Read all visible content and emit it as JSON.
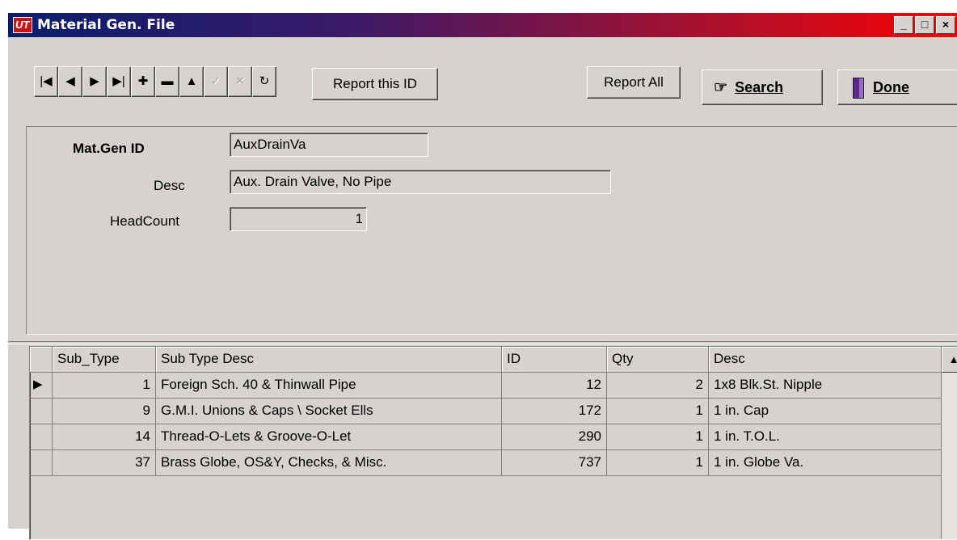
{
  "window": {
    "title": "Material Gen. File",
    "app_icon": "ut-logo-icon",
    "caption_buttons": [
      "_",
      "□",
      "×"
    ]
  },
  "toolbar": {
    "nav_buttons": [
      {
        "name": "first-record-button",
        "glyph": "|◀",
        "enabled": true
      },
      {
        "name": "prev-record-button",
        "glyph": "◀",
        "enabled": true
      },
      {
        "name": "next-record-button",
        "glyph": "▶",
        "enabled": true
      },
      {
        "name": "last-record-button",
        "glyph": "▶|",
        "enabled": true
      },
      {
        "name": "add-record-button",
        "glyph": "✚",
        "enabled": true
      },
      {
        "name": "delete-record-button",
        "glyph": "▬",
        "enabled": true
      },
      {
        "name": "edit-record-button",
        "glyph": "▲",
        "enabled": true
      },
      {
        "name": "post-record-button",
        "glyph": "✓",
        "enabled": false
      },
      {
        "name": "cancel-record-button",
        "glyph": "✕",
        "enabled": false
      },
      {
        "name": "refresh-button",
        "glyph": "↻",
        "enabled": true
      }
    ],
    "report_this_id": "Report this ID",
    "report_all": "Report All",
    "search": "Search",
    "done": "Done"
  },
  "form": {
    "mat_gen_id_label": "Mat.Gen ID",
    "mat_gen_id_value": "AuxDrainVa",
    "desc_label": "Desc",
    "desc_value": "Aux. Drain Valve, No Pipe",
    "headcount_label": "HeadCount",
    "headcount_value": "1"
  },
  "grid": {
    "columns": [
      "Sub_Type",
      "Sub Type Desc",
      "ID",
      "Qty",
      "Desc"
    ],
    "rows": [
      {
        "sub_type": "1",
        "sub_type_desc": "Foreign Sch. 40 & Thinwall Pipe",
        "id": "12",
        "qty": "2",
        "desc": "1x8 Blk.St. Nipple",
        "current": true
      },
      {
        "sub_type": "9",
        "sub_type_desc": "G.M.I. Unions & Caps \\ Socket Ells",
        "id": "172",
        "qty": "1",
        "desc": "1 in. Cap",
        "current": false
      },
      {
        "sub_type": "14",
        "sub_type_desc": "Thread-O-Lets & Groove-O-Let",
        "id": "290",
        "qty": "1",
        "desc": "1 in. T.O.L.",
        "current": false
      },
      {
        "sub_type": "37",
        "sub_type_desc": "Brass Globe, OS&Y, Checks, & Misc.",
        "id": "737",
        "qty": "1",
        "desc": "1 in. Globe Va.",
        "current": false
      }
    ]
  }
}
